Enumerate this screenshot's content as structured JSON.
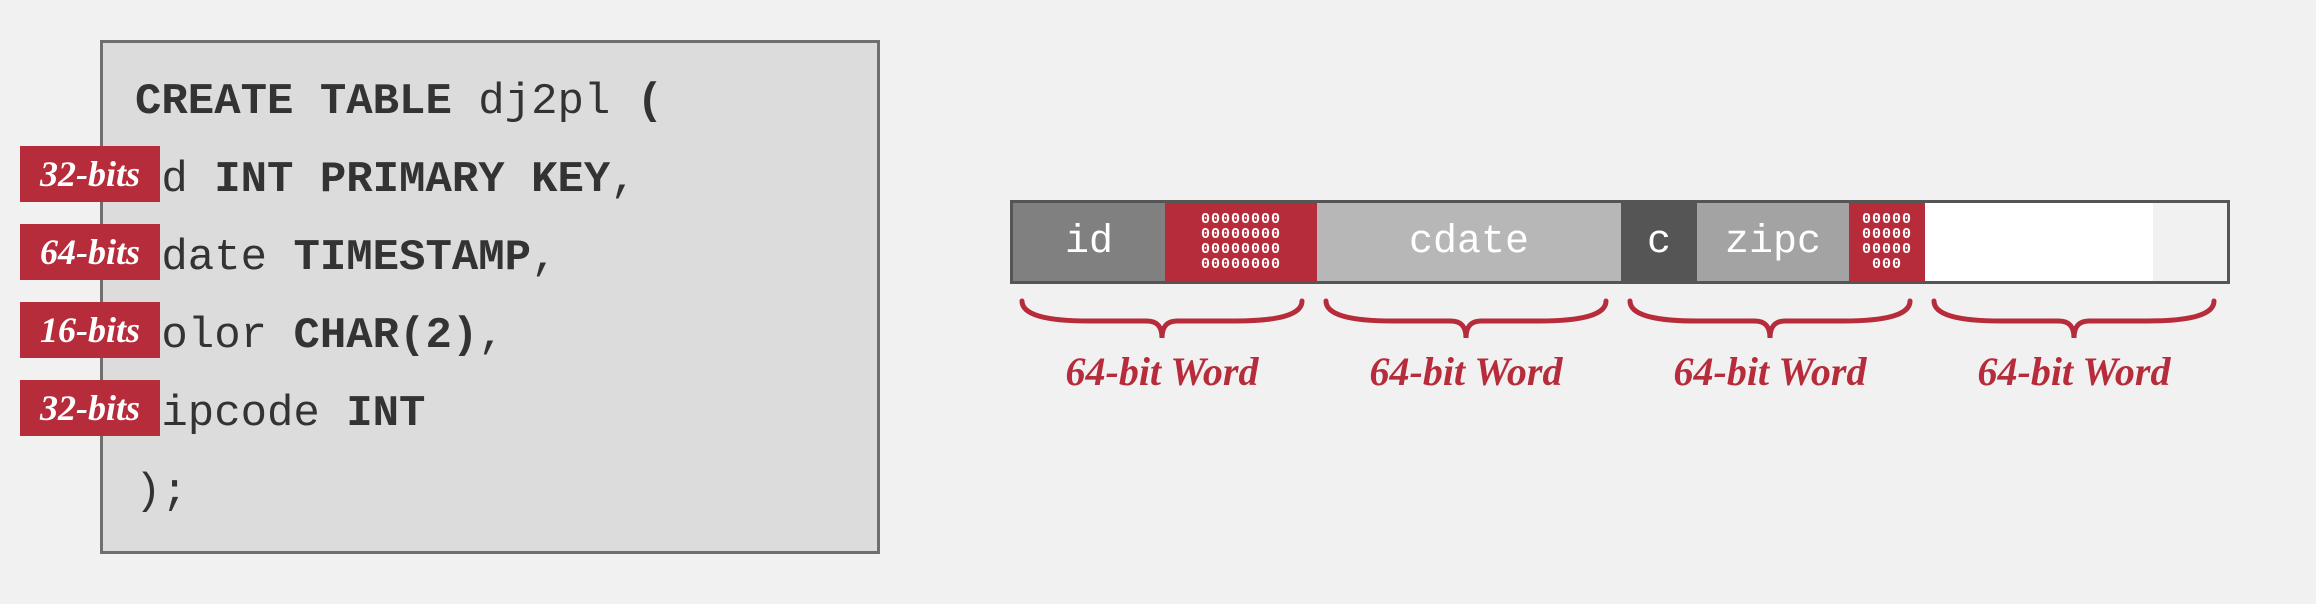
{
  "sql": {
    "create": "CREATE TABLE",
    "table_name": "dj2pl",
    "open": "(",
    "columns": [
      {
        "bits": "32-bits",
        "name": "id",
        "type": "INT PRIMARY KEY",
        "term": ","
      },
      {
        "bits": "64-bits",
        "name": "cdate",
        "type": "TIMESTAMP",
        "term": ","
      },
      {
        "bits": "16-bits",
        "name": "color",
        "type": "CHAR(2)",
        "term": ","
      },
      {
        "bits": "32-bits",
        "name": "zipcode",
        "type": "INT",
        "term": ""
      }
    ],
    "close": ");"
  },
  "layout": {
    "slots": [
      {
        "label": "id",
        "cls": "dark1 w32"
      },
      {
        "label": "00000000\n00000000\n00000000\n00000000",
        "cls": "pad w32"
      },
      {
        "label": "cdate",
        "cls": "light1 w64"
      },
      {
        "label": "c",
        "cls": "dark2 w16"
      },
      {
        "label": "zipc",
        "cls": "light2 w32"
      },
      {
        "label": "00000\n00000\n00000\n000",
        "cls": "pad w16"
      },
      {
        "label": "",
        "cls": "white w48"
      }
    ],
    "word_label": "64-bit Word",
    "word_count": 4
  },
  "colors": {
    "accent": "#b72c3b"
  }
}
